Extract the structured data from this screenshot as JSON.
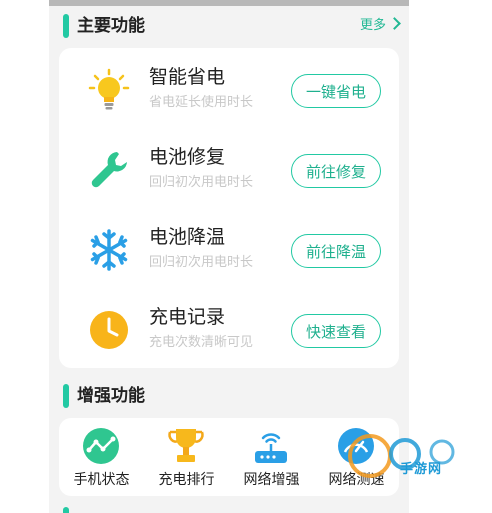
{
  "main_section": {
    "title": "主要功能",
    "more_label": "更多"
  },
  "features": [
    {
      "icon": "lightbulb-icon",
      "title": "智能省电",
      "subtitle": "省电延长使用时长",
      "button": "一键省电"
    },
    {
      "icon": "wrench-icon",
      "title": "电池修复",
      "subtitle": "回归初次用电时长",
      "button": "前往修复"
    },
    {
      "icon": "snowflake-icon",
      "title": "电池降温",
      "subtitle": "回归初次用电时长",
      "button": "前往降温"
    },
    {
      "icon": "clock-icon",
      "title": "充电记录",
      "subtitle": "充电次数清晰可见",
      "button": "快速查看"
    }
  ],
  "enhance_section": {
    "title": "增强功能"
  },
  "tools": [
    {
      "icon": "phone-status-icon",
      "label": "手机状态"
    },
    {
      "icon": "trophy-icon",
      "label": "充电排行"
    },
    {
      "icon": "router-icon",
      "label": "网络增强"
    },
    {
      "icon": "speed-test-icon",
      "label": "网络测速"
    }
  ],
  "watermark": {
    "text": "手游网"
  },
  "colors": {
    "accent": "#22c9a3",
    "button_text": "#1fb08e",
    "background": "#f3f3f3",
    "card": "#ffffff"
  }
}
